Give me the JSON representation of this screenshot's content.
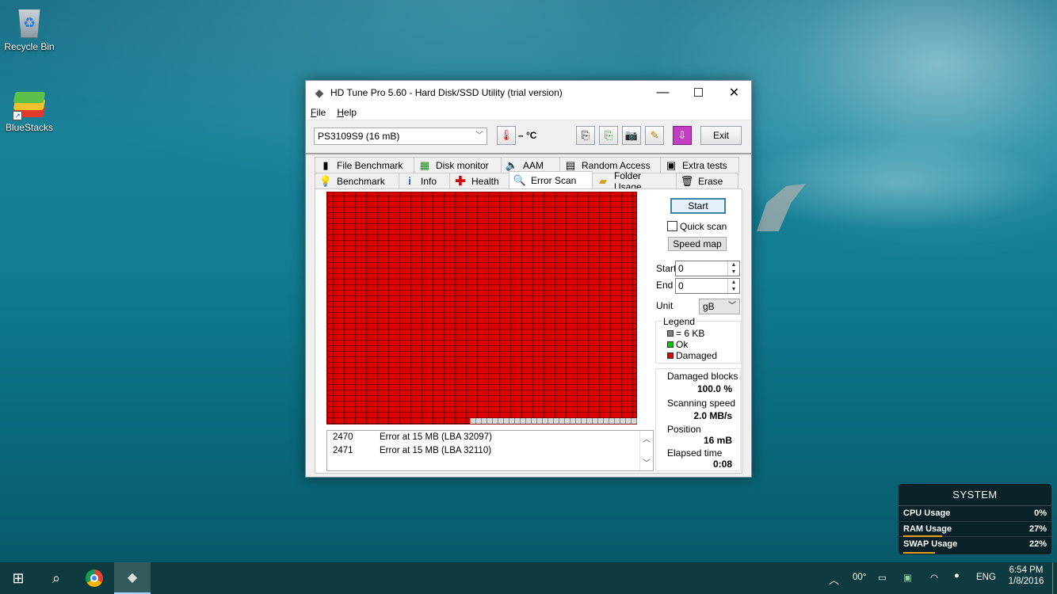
{
  "desktop": {
    "icons": [
      {
        "label": "Recycle Bin"
      },
      {
        "label": "BlueStacks"
      }
    ]
  },
  "window": {
    "title": "HD Tune Pro 5.60 - Hard Disk/SSD Utility (trial version)",
    "controls": {
      "minimize": "—",
      "maximize": "☐",
      "close": "✕"
    },
    "menu": [
      {
        "underline": "F",
        "rest": "ile"
      },
      {
        "underline": "H",
        "rest": "elp"
      }
    ],
    "toolbar": {
      "drive": "PS3109S9 (16 mB)",
      "temperature": "– °C",
      "exit_label": "Exit"
    },
    "tabs_row1": [
      {
        "label": "File Benchmark",
        "icon": "file-benchmark-icon"
      },
      {
        "label": "Disk monitor",
        "icon": "disk-monitor-icon"
      },
      {
        "label": "AAM",
        "icon": "speaker-icon"
      },
      {
        "label": "Random Access",
        "icon": "random-access-icon"
      },
      {
        "label": "Extra tests",
        "icon": "extra-tests-icon"
      }
    ],
    "tabs_row2": [
      {
        "label": "Benchmark",
        "icon": "lightbulb-icon"
      },
      {
        "label": "Info",
        "icon": "info-icon"
      },
      {
        "label": "Health",
        "icon": "health-cross-icon"
      },
      {
        "label": "Error Scan",
        "icon": "magnifier-icon",
        "active": true
      },
      {
        "label": "Folder Usage",
        "icon": "folder-icon"
      },
      {
        "label": "Erase",
        "icon": "trash-icon"
      }
    ],
    "error_scan": {
      "start_button": "Start",
      "quick_scan_label": "Quick scan",
      "quick_scan_checked": false,
      "speed_map_button": "Speed map",
      "start_label": "Start",
      "start_value": "0",
      "end_label": "End",
      "end_value": "0",
      "unit_label": "Unit",
      "unit_value": "gB",
      "legend": {
        "title": "Legend",
        "block_size": "= 6 KB",
        "ok": "Ok",
        "damaged": "Damaged",
        "colors": {
          "block": "#808080",
          "ok": "#00c800",
          "damaged": "#e00000"
        }
      },
      "stats": {
        "damaged_blocks_label": "Damaged blocks",
        "damaged_blocks_value": "100.0 %",
        "scanning_speed_label": "Scanning speed",
        "scanning_speed_value": "2.0 MB/s",
        "position_label": "Position",
        "position_value": "16 mB",
        "elapsed_label": "Elapsed time",
        "elapsed_value": "0:08"
      },
      "log": [
        {
          "num": "2470",
          "msg": "Error at 15 MB (LBA 32097)"
        },
        {
          "num": "2471",
          "msg": "Error at 15 MB (LBA 32110)"
        }
      ]
    }
  },
  "system_widget": {
    "title": "SYSTEM",
    "rows": [
      {
        "label": "CPU Usage",
        "value": "0%",
        "percent": 0
      },
      {
        "label": "RAM Usage",
        "value": "27%",
        "percent": 27
      },
      {
        "label": "SWAP Usage",
        "value": "22%",
        "percent": 22
      }
    ]
  },
  "taskbar": {
    "weather": "00°",
    "language": "ENG",
    "time": "6:54 PM",
    "date": "1/8/2016"
  }
}
